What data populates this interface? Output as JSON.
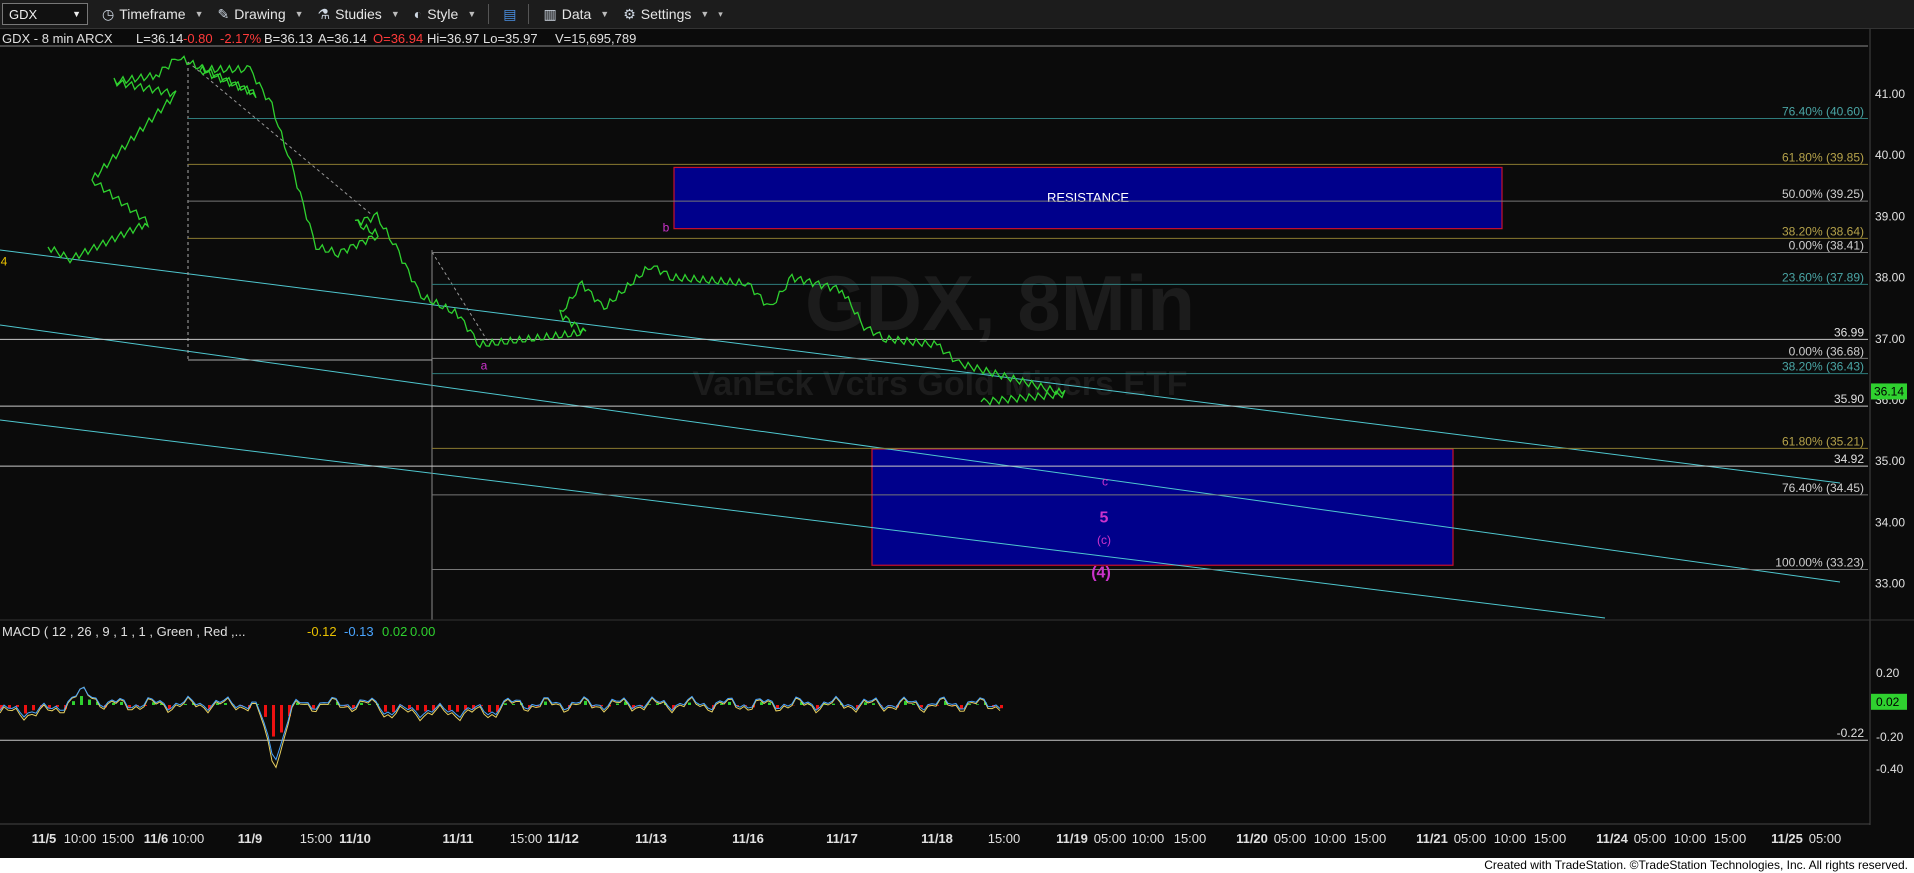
{
  "toolbar": {
    "symbol": "GDX",
    "items": [
      {
        "icon": "clock-icon",
        "label": "Timeframe"
      },
      {
        "icon": "pencil-icon",
        "label": "Drawing"
      },
      {
        "icon": "flask-icon",
        "label": "Studies"
      },
      {
        "icon": "palette-icon",
        "label": "Style"
      },
      {
        "icon": "layout-icon",
        "label": ""
      },
      {
        "icon": "bar-chart-icon",
        "label": "Data"
      },
      {
        "icon": "gear-icon",
        "label": "Settings"
      }
    ]
  },
  "header": {
    "symbol_info": "GDX - 8 min  ARCX",
    "last": "L=36.14",
    "change": "-0.80",
    "pct": "-2.17%",
    "bid": "B=36.13",
    "ask": "A=36.14",
    "open": "O=36.94",
    "high": "Hi=36.97",
    "low": "Lo=35.97",
    "volume": "V=15,695,789"
  },
  "watermark": {
    "title": "GDX, 8Min",
    "subtitle": "VanEck Vctrs Gold Miners ETF"
  },
  "colors": {
    "price": "#2fd12f",
    "zone": "#00008b",
    "zone_border": "#c8102e",
    "wave": "#cc33cc",
    "fib_teal": "#4aa5a5",
    "fib_gold": "#b5a24a",
    "macd_pos": "#2fd12f",
    "macd_neg": "#ee1111"
  },
  "chart_data": {
    "type": "line",
    "title": "GDX - 8 min",
    "x_ticks": [
      "11/5",
      "10:00",
      "15:00",
      "11/6",
      "10:00",
      "11/9",
      "15:00",
      "11/10",
      "11/11",
      "15:00",
      "11/12",
      "11/13",
      "11/16",
      "11/17",
      "11/18",
      "15:00",
      "11/19",
      "05:00",
      "10:00",
      "15:00",
      "11/20",
      "05:00",
      "10:00",
      "15:00",
      "11/21",
      "05:00",
      "10:00",
      "15:00",
      "11/24",
      "05:00",
      "10:00",
      "15:00",
      "11/25",
      "05:00"
    ],
    "y_ticks": [
      41,
      40,
      39,
      38,
      37,
      36,
      35,
      34,
      33
    ],
    "ylim": [
      32.6,
      41.8
    ],
    "series": [
      {
        "name": "GDX",
        "points": [
          [
            "11/5",
            38.5
          ],
          [
            "11/5",
            38.3
          ],
          [
            "11/5 10:00",
            38.9
          ],
          [
            "11/5",
            39.6
          ],
          [
            "11/5 15:00",
            41.0
          ],
          [
            "11/5",
            41.2
          ],
          [
            "11/6",
            41.3
          ],
          [
            "11/6",
            41.6
          ],
          [
            "11/6 10:00",
            41.0
          ],
          [
            "11/6",
            41.4
          ],
          [
            "11/9",
            41.4
          ],
          [
            "11/9",
            40.8
          ],
          [
            "11/9",
            39.7
          ],
          [
            "11/9",
            38.5
          ],
          [
            "11/9",
            38.4
          ],
          [
            "11/9 15:00",
            38.7
          ],
          [
            "11/10",
            38.9
          ],
          [
            "11/10",
            39.0
          ],
          [
            "11/10",
            38.4
          ],
          [
            "11/10",
            37.7
          ],
          [
            "11/11",
            37.4
          ],
          [
            "11/11",
            36.9
          ],
          [
            "11/11 15:00",
            37.1
          ],
          [
            "11/12",
            37.4
          ],
          [
            "11/12",
            37.9
          ],
          [
            "11/12",
            37.5
          ],
          [
            "11/13",
            38.2
          ],
          [
            "11/13",
            38.0
          ],
          [
            "11/16",
            37.9
          ],
          [
            "11/16",
            37.5
          ],
          [
            "11/16",
            38.0
          ],
          [
            "11/17",
            37.8
          ],
          [
            "11/17",
            37.2
          ],
          [
            "11/17",
            37.0
          ],
          [
            "11/18",
            36.9
          ],
          [
            "11/18",
            36.6
          ],
          [
            "11/18 15:00",
            36.1
          ],
          [
            "11/18",
            35.97
          ]
        ]
      }
    ],
    "fib_levels": [
      {
        "label": "76.40% (40.60)",
        "value": 40.6
      },
      {
        "label": "61.80% (39.85)",
        "value": 39.85
      },
      {
        "label": "50.00% (39.25)",
        "value": 39.25
      },
      {
        "label": "38.20% (38.64)",
        "value": 38.64
      },
      {
        "label": "0.00% (38.41)",
        "value": 38.41
      },
      {
        "label": "23.60% (37.89)",
        "value": 37.89
      },
      {
        "label": "0.00% (36.68)",
        "value": 36.68
      },
      {
        "label": "38.20% (36.43)",
        "value": 36.43
      },
      {
        "label": "61.80% (35.21)",
        "value": 35.21
      },
      {
        "label": "76.40% (34.45)",
        "value": 34.45
      },
      {
        "label": "100.00% (33.23)",
        "value": 33.23
      }
    ],
    "horizontal_levels": [
      {
        "label": "36.99",
        "value": 36.99
      },
      {
        "label": "35.90",
        "value": 35.9
      },
      {
        "label": "34.92",
        "value": 34.92
      }
    ],
    "zones": [
      {
        "label": "RESISTANCE",
        "from_x": "11/13",
        "to_x": "11/21",
        "low": 38.8,
        "high": 39.8
      },
      {
        "label": "",
        "from_x": "11/17",
        "to_x": "11/21",
        "low": 33.3,
        "high": 35.2
      }
    ],
    "wave_labels": [
      {
        "text": "4",
        "at": "11/5",
        "value": 38.2,
        "color": "#e8c000"
      },
      {
        "text": "a",
        "at": "11/11",
        "value": 36.5,
        "color": "#cc33cc"
      },
      {
        "text": "b",
        "at": "11/13",
        "value": 38.75,
        "color": "#cc33cc"
      },
      {
        "text": "c",
        "at": "11/19",
        "value": 34.6,
        "color": "#cc33cc"
      },
      {
        "text": "5",
        "at": "11/19",
        "value": 34.0,
        "color": "#cc33cc"
      },
      {
        "text": "(c)",
        "at": "11/19",
        "value": 33.65,
        "color": "#cc33cc"
      },
      {
        "text": "(4)",
        "at": "11/19",
        "value": 33.1,
        "color": "#cc33cc"
      }
    ],
    "last_price_badge": "36.14"
  },
  "macd": {
    "label": "MACD ( 12 , 26 , 9 , 1 , 1 , Green , Red ,...",
    "v1": "-0.12",
    "v2": "-0.13",
    "v3": "0.02",
    "v4": "0.00",
    "y_ticks": [
      "0.20",
      "-0.20",
      "-0.40"
    ],
    "level_label": "-0.22",
    "badge": "0.02"
  },
  "footer": "Created with TradeStation. ©TradeStation Technologies, Inc. All rights reserved."
}
